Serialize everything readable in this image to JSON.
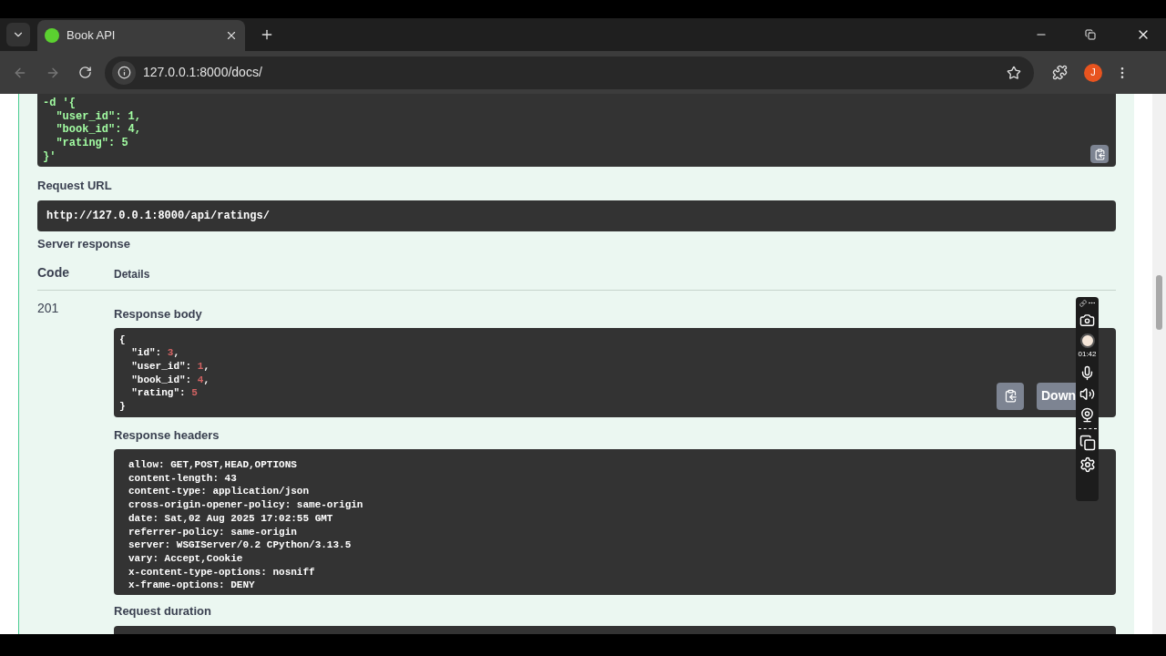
{
  "browser": {
    "tab": {
      "title": "Book API",
      "selected": true
    },
    "address": "127.0.0.1:8000/docs/",
    "profile_initial": "J"
  },
  "curl_tail": [
    "-d '{",
    "  \"user_id\": 1,",
    "  \"book_id\": 4,",
    "  \"rating\": 5",
    "}'"
  ],
  "request_url": {
    "label": "Request URL",
    "value": "http://127.0.0.1:8000/api/ratings/"
  },
  "server_response": {
    "label": "Server response",
    "columns": [
      "Code",
      "Details"
    ],
    "code": "201",
    "body": {
      "label": "Response body",
      "open": "{",
      "close": "}",
      "lines": [
        {
          "key": "\"id\":",
          "value": "3",
          "comma": ","
        },
        {
          "key": "\"user_id\":",
          "value": "1",
          "comma": ","
        },
        {
          "key": "\"book_id\":",
          "value": "4",
          "comma": ","
        },
        {
          "key": "\"rating\":",
          "value": "5"
        }
      ],
      "download": "Down"
    },
    "headers": {
      "label": "Response headers",
      "lines": [
        "allow: GET,POST,HEAD,OPTIONS",
        "content-length: 43",
        "content-type: application/json",
        "cross-origin-opener-policy: same-origin",
        "date: Sat,02 Aug 2025 17:02:55 GMT",
        "referrer-policy: same-origin",
        "server: WSGIServer/0.2 CPython/3.13.5",
        "vary: Accept,Cookie",
        "x-content-type-options: nosniff",
        "x-frame-options: DENY"
      ]
    },
    "duration": {
      "label": "Request duration"
    }
  },
  "recorder": {
    "timer": "01:42"
  }
}
